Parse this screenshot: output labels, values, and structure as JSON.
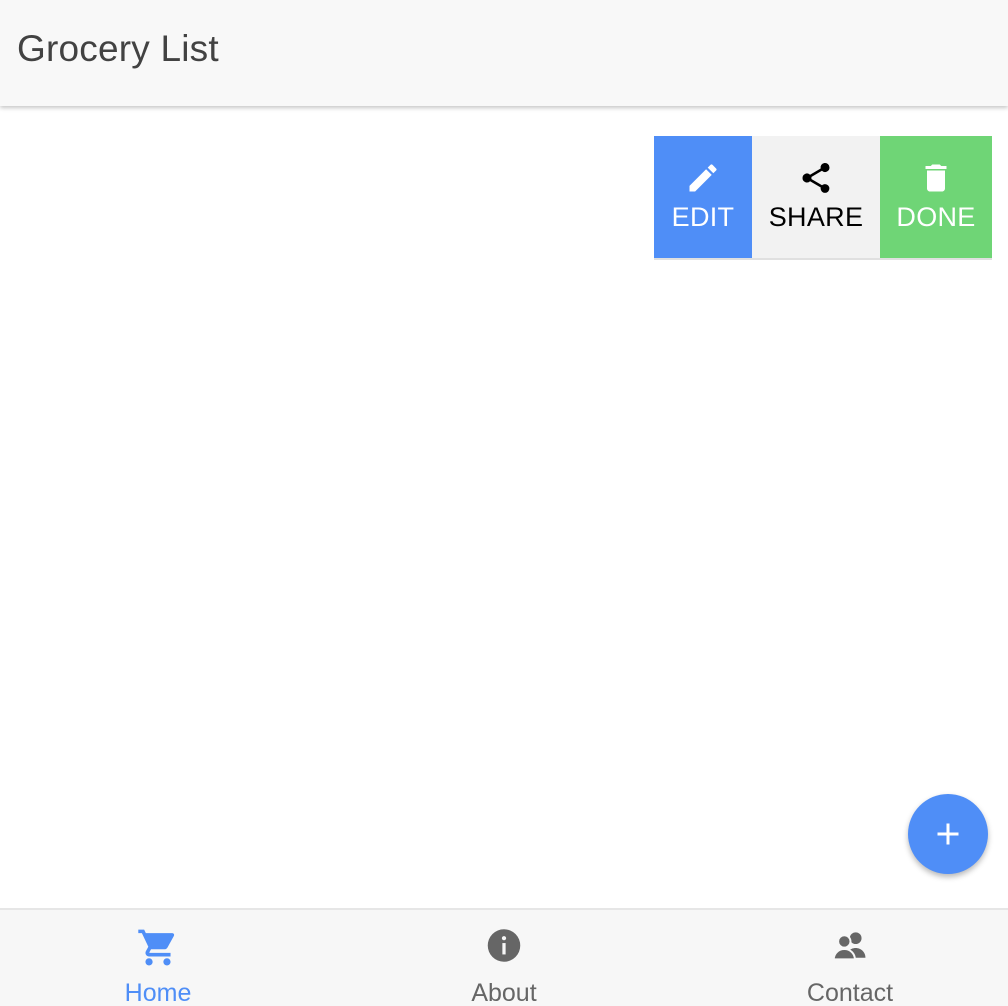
{
  "header": {
    "title": "Grocery List"
  },
  "actions": {
    "edit_label": "EDIT",
    "share_label": "SHARE",
    "done_label": "DONE",
    "edit_icon": "pencil-icon",
    "share_icon": "share-icon",
    "done_icon": "trash-icon"
  },
  "fab": {
    "icon": "plus-icon"
  },
  "nav": {
    "items": [
      {
        "label": "Home",
        "icon": "cart-icon",
        "active": true
      },
      {
        "label": "About",
        "icon": "info-icon",
        "active": false
      },
      {
        "label": "Contact",
        "icon": "contacts-icon",
        "active": false
      }
    ]
  },
  "colors": {
    "accent": "#4f8ef7",
    "done": "#6fd576",
    "share_bg": "#f2f2f2",
    "header_bg": "#f8f8f8",
    "inactive": "#666666"
  }
}
